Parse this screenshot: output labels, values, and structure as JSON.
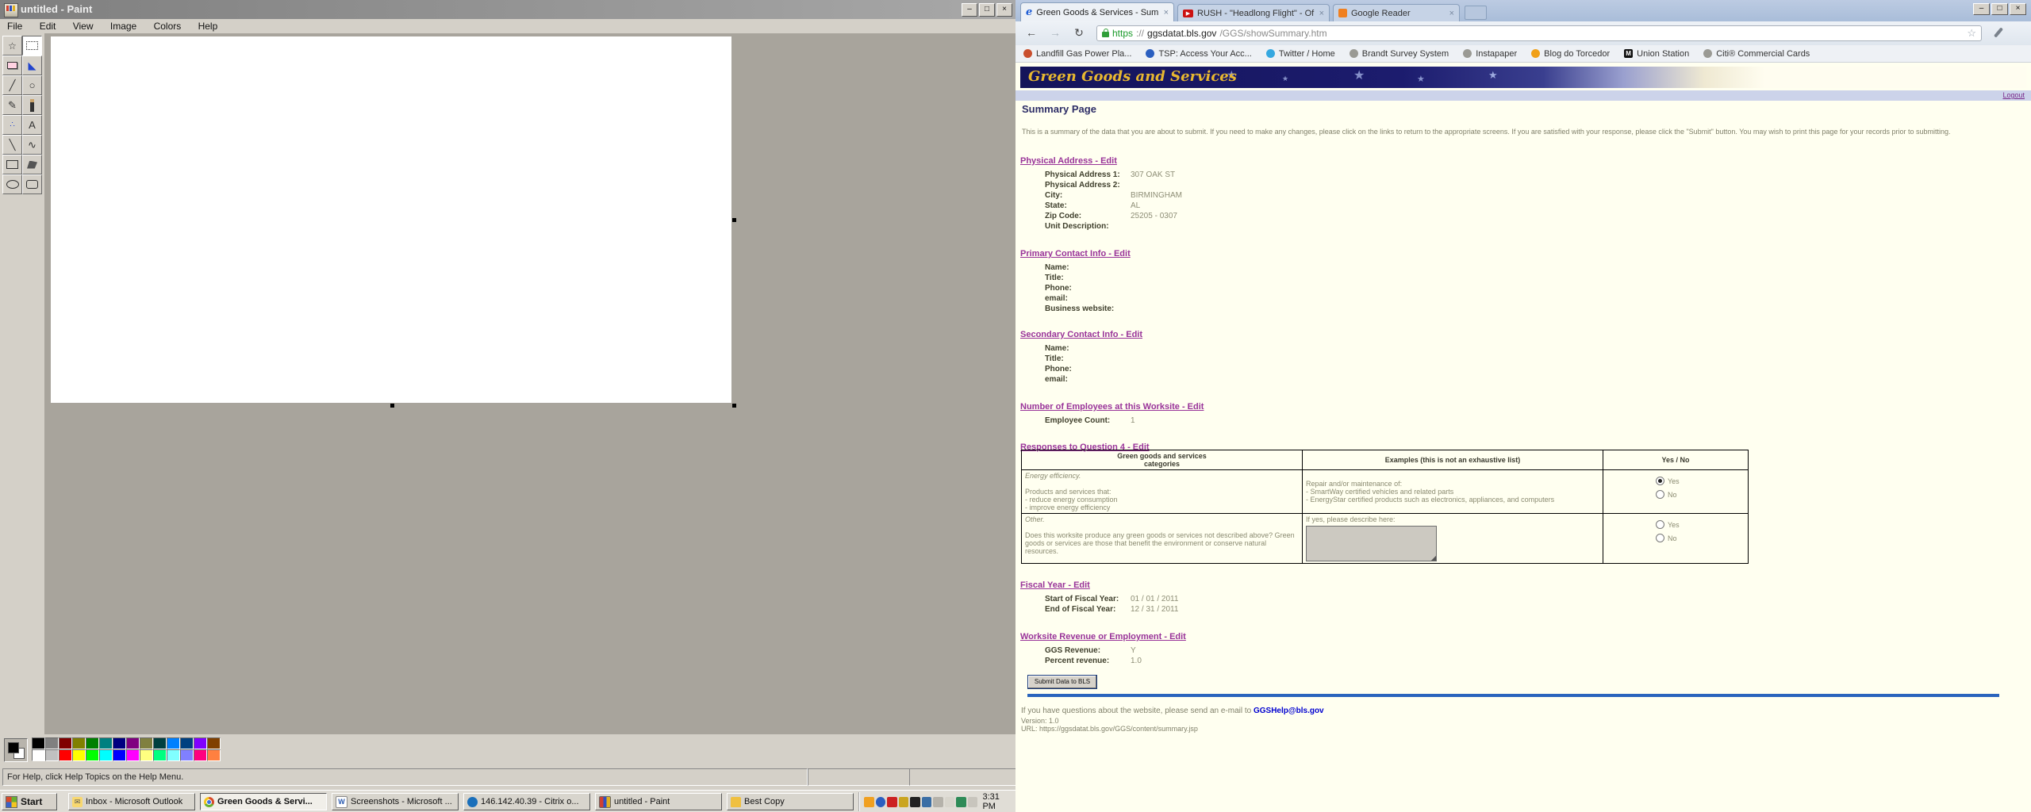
{
  "paint": {
    "title": "untitled - Paint",
    "window_buttons": {
      "minimize": "–",
      "restore": "□",
      "close": "×"
    },
    "menus": [
      "File",
      "Edit",
      "View",
      "Image",
      "Colors",
      "Help"
    ],
    "tools": [
      {
        "name": "free-form-select",
        "glyph": "☆"
      },
      {
        "name": "select",
        "glyph": ""
      },
      {
        "name": "eraser",
        "glyph": ""
      },
      {
        "name": "fill-with-color",
        "glyph": "◣"
      },
      {
        "name": "pick-color",
        "glyph": "╱"
      },
      {
        "name": "magnifier",
        "glyph": "○"
      },
      {
        "name": "pencil",
        "glyph": "✎"
      },
      {
        "name": "brush",
        "glyph": ""
      },
      {
        "name": "airbrush",
        "glyph": "∴"
      },
      {
        "name": "text",
        "glyph": "A"
      },
      {
        "name": "line",
        "glyph": "╲"
      },
      {
        "name": "curve",
        "glyph": "∿"
      },
      {
        "name": "rectangle",
        "glyph": ""
      },
      {
        "name": "polygon",
        "glyph": ""
      },
      {
        "name": "ellipse",
        "glyph": ""
      },
      {
        "name": "rounded-rectangle",
        "glyph": ""
      }
    ],
    "palette": {
      "foreground": "#000000",
      "background": "#ffffff",
      "colors": [
        "#000000",
        "#808080",
        "#800000",
        "#808000",
        "#008000",
        "#008080",
        "#000080",
        "#800080",
        "#808040",
        "#004040",
        "#0080ff",
        "#004080",
        "#8000ff",
        "#804000",
        "#ffffff",
        "#c0c0c0",
        "#ff0000",
        "#ffff00",
        "#00ff00",
        "#00ffff",
        "#0000ff",
        "#ff00ff",
        "#ffff80",
        "#00ff80",
        "#80ffff",
        "#8080ff",
        "#ff0080",
        "#ff8040"
      ]
    },
    "status": {
      "help_text": "For Help, click Help Topics on the Help Menu."
    }
  },
  "browser": {
    "window_buttons": {
      "minimize": "–",
      "restore": "□",
      "close": "×"
    },
    "tabs": [
      {
        "title": "Green Goods & Services - Sum",
        "favicon_text": "e",
        "close": "×"
      },
      {
        "title": "RUSH - \"Headlong Flight\" - Of",
        "favicon_text": "▶",
        "close": "×"
      },
      {
        "title": "Google Reader",
        "close": "×"
      }
    ],
    "nav": {
      "back": "←",
      "forward": "→",
      "reload": "↻",
      "star": "☆"
    },
    "url": {
      "scheme": "https",
      "separator": "://",
      "host": "ggsdatat.bls.gov",
      "path": "/GGS/showSummary.htm"
    },
    "bookmarks": [
      {
        "label": "Landfill Gas Power Pla...",
        "icon_color": "#c94f2e"
      },
      {
        "label": "TSP: Access Your Acc...",
        "icon_color": "#2b5fc0"
      },
      {
        "label": "Twitter / Home",
        "icon_color": "#35a8e0"
      },
      {
        "label": "Brandt Survey System",
        "icon_color": "#9a9a94"
      },
      {
        "label": "Instapaper",
        "icon_color": "#9a9a94"
      },
      {
        "label": "Blog do Torcedor",
        "icon_color": "#f0a018"
      },
      {
        "label": "Union Station",
        "icon_color": "#111111",
        "icon_text": "M"
      },
      {
        "label": "Citi® Commercial Cards",
        "icon_color": "#9a9a94"
      }
    ],
    "page": {
      "banner_title": "Green Goods and Services",
      "logout": "Logout",
      "heading": "Summary Page",
      "intro": "This is a summary of the data that you are about to submit. If you need to make any changes, please click on the links to return to the appropriate screens. If you are satisfied with your response, please click the \"Submit\" button. You may wish to print this page for your records prior to submitting.",
      "sections": [
        {
          "title": "Physical Address - Edit",
          "rows": [
            {
              "label": "Physical Address 1:",
              "value": "307 OAK ST"
            },
            {
              "label": "Physical Address 2:",
              "value": ""
            },
            {
              "label": "City:",
              "value": "BIRMINGHAM"
            },
            {
              "label": "State:",
              "value": "AL"
            },
            {
              "label": "Zip Code:",
              "value": "25205 - 0307"
            },
            {
              "label": "Unit Description:",
              "value": ""
            }
          ]
        },
        {
          "title": "Primary Contact Info - Edit",
          "rows": [
            {
              "label": "Name:",
              "value": ""
            },
            {
              "label": "Title:",
              "value": ""
            },
            {
              "label": "Phone:",
              "value": ""
            },
            {
              "label": "email:",
              "value": ""
            },
            {
              "label": "Business website:",
              "value": ""
            }
          ]
        },
        {
          "title": "Secondary Contact Info - Edit",
          "rows": [
            {
              "label": "Name:",
              "value": ""
            },
            {
              "label": "Title:",
              "value": ""
            },
            {
              "label": "Phone:",
              "value": ""
            },
            {
              "label": "email:",
              "value": ""
            }
          ]
        },
        {
          "title": "Number of Employees at this Worksite - Edit",
          "rows": [
            {
              "label": "Employee Count:",
              "value": "1"
            }
          ]
        },
        {
          "title": "Fiscal Year - Edit",
          "rows": [
            {
              "label": "Start of Fiscal Year:",
              "value": "01 / 01 / 2011"
            },
            {
              "label": "End of Fiscal Year:",
              "value": "12 / 31 / 2011"
            }
          ]
        },
        {
          "title": "Worksite Revenue or Employment - Edit",
          "rows": [
            {
              "label": "GGS Revenue:",
              "value": "Y"
            },
            {
              "label": "Percent revenue:",
              "value": "1.0"
            }
          ]
        }
      ],
      "q4": {
        "link": "Responses to Question 4 - Edit",
        "headers": {
          "col1a": "Green goods and services",
          "col1b": "categories",
          "col2": "Examples (this is not an exhaustive list)",
          "col3": "Yes / No"
        },
        "yes_label": "Yes",
        "no_label": "No",
        "row1": {
          "title": "Energy efficiency.",
          "line1": "Products and services that:",
          "line2": "- reduce energy consumption",
          "line3": "- improve energy efficiency",
          "ex1": "Repair and/or maintenance of:",
          "ex2": "- SmartWay certified vehicles and related parts",
          "ex3": "- EnergyStar certified products such as electronics, appliances, and computers"
        },
        "row2": {
          "title": "Other.",
          "desc": "Does this worksite produce any green goods or services not described above? Green goods or services are those that benefit the environment or conserve natural resources.",
          "ex_label": "If yes, please describe here:"
        }
      },
      "submit_label": "Submit Data to BLS",
      "footer": {
        "help_prefix": "If you have questions about the website, please send an e-mail to ",
        "help_link": "GGSHelp@bls.gov",
        "version": "Version: 1.0",
        "url": "URL: https://ggsdatat.bls.gov/GGS/content/summary.jsp"
      }
    }
  },
  "taskbar": {
    "start_label": "Start",
    "buttons": [
      {
        "label": "Inbox - Microsoft Outlook"
      },
      {
        "label": "Green Goods & Servi..."
      },
      {
        "label": "Screenshots - Microsoft ..."
      },
      {
        "label": "146.142.40.39 - Citrix o..."
      },
      {
        "label": "untitled - Paint"
      },
      {
        "label": "Best Copy"
      }
    ],
    "tray": [
      {
        "name": "reminder",
        "color": "#f0a020"
      },
      {
        "name": "messenger",
        "color": "#2b5fc0"
      },
      {
        "name": "antivirus",
        "color": "#cc2222"
      },
      {
        "name": "lock",
        "color": "#caa520"
      },
      {
        "name": "phone",
        "color": "#222222"
      },
      {
        "name": "display",
        "color": "#3a6ea5"
      },
      {
        "name": "volume-muted",
        "color": "#b5b2aa"
      },
      {
        "name": "network",
        "color": "#d8d5cc"
      },
      {
        "name": "shield",
        "color": "#2e8b57"
      },
      {
        "name": "pointer",
        "color": "#c8c5bd"
      }
    ],
    "clock": "3:31 PM"
  }
}
